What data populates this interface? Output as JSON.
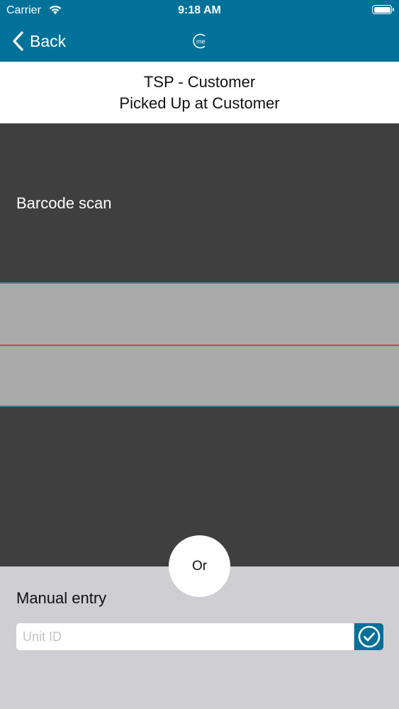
{
  "status_bar": {
    "carrier": "Carrier",
    "time": "9:18 AM",
    "wifi_icon": "wifi-icon",
    "battery_icon": "battery-icon"
  },
  "nav": {
    "back_label": "Back",
    "logo_icon": "me-logo-icon",
    "color": "#02719a"
  },
  "header": {
    "line1": "TSP - Customer",
    "line2": "Picked Up at Customer"
  },
  "scanner": {
    "label": "Barcode scan",
    "scan_line_color": "#e0442a"
  },
  "divider": {
    "or_label": "Or"
  },
  "manual": {
    "label": "Manual entry",
    "unit_id_placeholder": "Unit ID",
    "unit_id_value": "",
    "confirm_icon": "check-circle-icon"
  }
}
